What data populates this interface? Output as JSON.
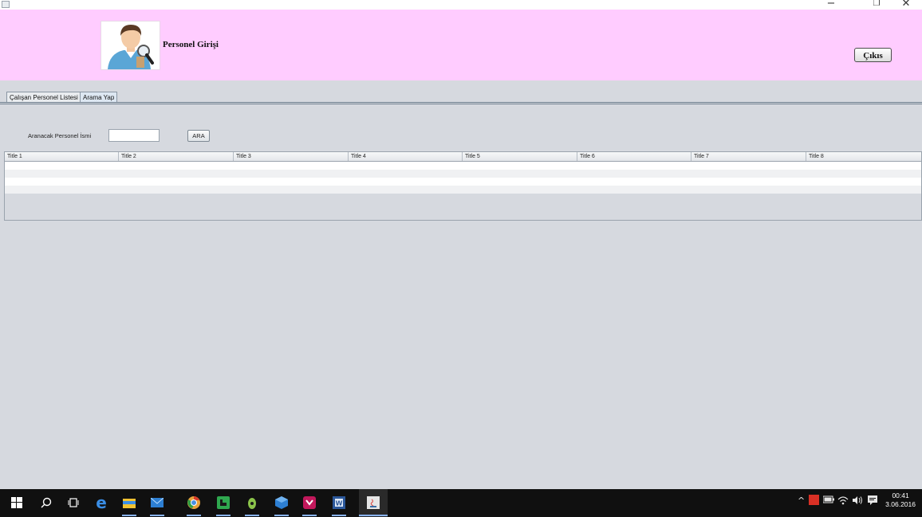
{
  "window": {
    "minimize_glyph": "−",
    "restore_glyph": "❐",
    "close_glyph": "✕"
  },
  "header": {
    "title": "Personel Girişi",
    "exit_button": "Çıkıs",
    "avatar_icon": "user-search-icon"
  },
  "tabs": [
    {
      "label": "Çalışan Personel Listesi",
      "active": false
    },
    {
      "label": "Arama Yap",
      "active": true
    }
  ],
  "search": {
    "label": "Aranacak Personel İsmi",
    "value": "",
    "button": "ARA"
  },
  "table": {
    "columns": [
      "Title 1",
      "Title 2",
      "Title 3",
      "Title 4",
      "Title 5",
      "Title 6",
      "Title 7",
      "Title 8"
    ],
    "rows": [
      [
        "",
        "",
        "",
        "",
        "",
        "",
        "",
        ""
      ],
      [
        "",
        "",
        "",
        "",
        "",
        "",
        "",
        ""
      ],
      [
        "",
        "",
        "",
        "",
        "",
        "",
        "",
        ""
      ],
      [
        "",
        "",
        "",
        "",
        "",
        "",
        "",
        ""
      ]
    ]
  },
  "taskbar": {
    "apps": [
      "start-icon",
      "search-icon",
      "task-view-icon",
      "edge-icon",
      "file-explorer-icon",
      "mail-icon",
      "chrome-icon",
      "camtasia-icon",
      "android-studio-icon",
      "virtualbox-icon",
      "visual-studio-icon",
      "word-icon",
      "java-app-icon"
    ],
    "time": "00:41",
    "date": "3.06.2016"
  }
}
